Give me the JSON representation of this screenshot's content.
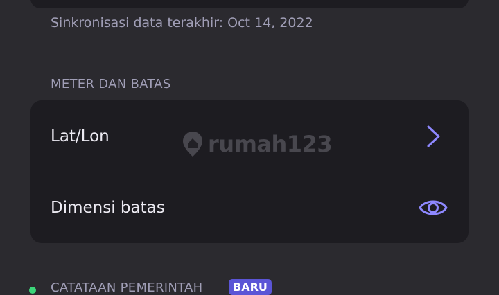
{
  "sync": {
    "label": "Sinkronisasi data terakhir: Oct 14, 2022"
  },
  "meters_section": {
    "title": "METER DAN BATAS",
    "rows": [
      {
        "label": "Lat/Lon",
        "icon": "chevron-right-icon"
      },
      {
        "label": "Dimensi batas",
        "icon": "eye-icon"
      }
    ]
  },
  "government_section": {
    "title": "CATATAAN PEMERINTAH",
    "badge": "BARU",
    "status_color": "#3cd67a"
  },
  "watermark": {
    "text": "rumah123",
    "icon": "map-pin-icon"
  },
  "colors": {
    "background": "#2b2a2f",
    "card": "#1d1c21",
    "accent": "#8e88ff",
    "badge": "#5b55d6"
  }
}
